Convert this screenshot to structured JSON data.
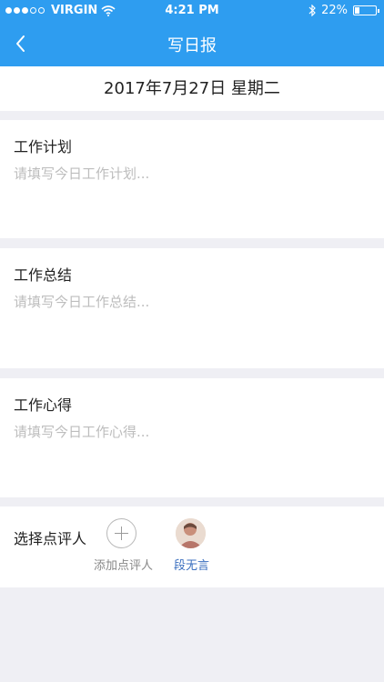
{
  "status_bar": {
    "carrier": "VIRGIN",
    "time": "4:21 PM",
    "battery": "22%",
    "battery_level": 0.22
  },
  "navbar": {
    "title": "写日报"
  },
  "date": "2017年7月27日 星期二",
  "sections": [
    {
      "label": "工作计划",
      "placeholder": "请填写今日工作计划..."
    },
    {
      "label": "工作总结",
      "placeholder": "请填写今日工作总结..."
    },
    {
      "label": "工作心得",
      "placeholder": "请填写今日工作心得..."
    }
  ],
  "reviewer": {
    "label": "选择点评人",
    "add_label": "添加点评人",
    "selected_name": "段无言"
  },
  "colors": {
    "accent": "#2e9df0",
    "link": "#3b6fbf",
    "background": "#efeff4"
  }
}
